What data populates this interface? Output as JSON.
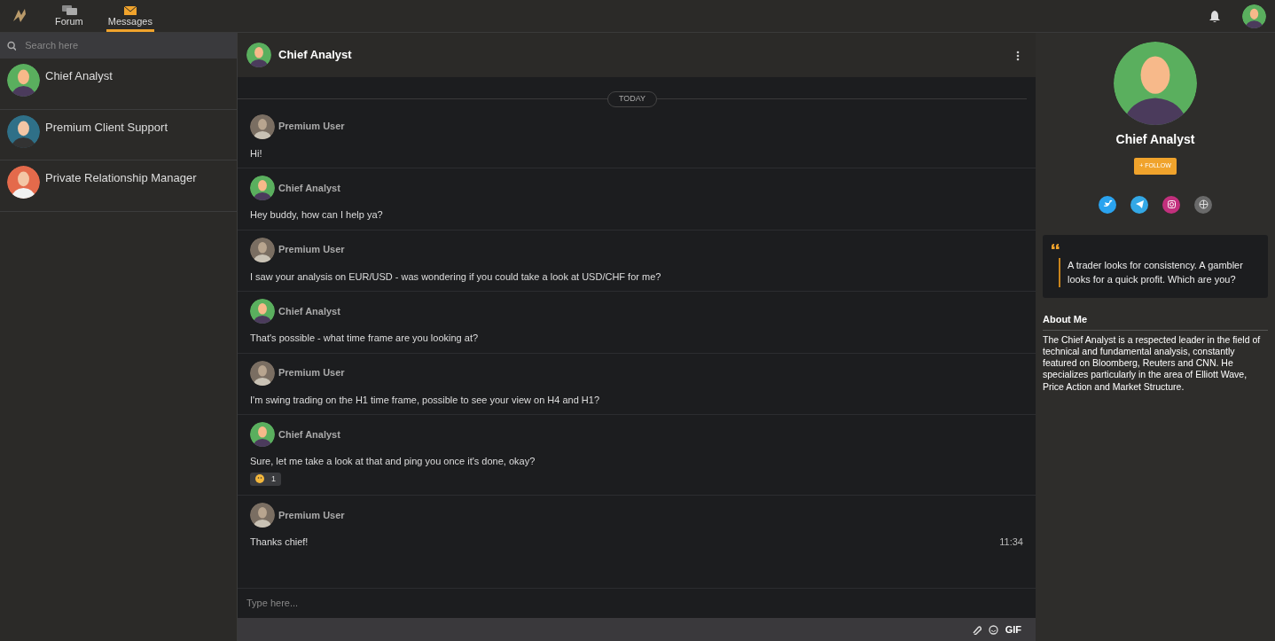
{
  "topbar": {
    "tabs": [
      {
        "label": "Forum",
        "selected": false
      },
      {
        "label": "Messages",
        "selected": true
      }
    ]
  },
  "sidebar": {
    "search": {
      "placeholder": "Search here"
    },
    "conversations": [
      {
        "name": "Chief Analyst",
        "kind": "analyst"
      },
      {
        "name": "Premium Client Support",
        "kind": "support"
      },
      {
        "name": "Private Relationship Manager",
        "kind": "manager"
      }
    ]
  },
  "chat": {
    "title": "Chief Analyst",
    "date_divider": "TODAY",
    "messages": [
      {
        "sender": "Premium User",
        "kind": "user",
        "text": "Hi!"
      },
      {
        "sender": "Chief Analyst",
        "kind": "analyst",
        "text": "Hey buddy, how can I help ya?"
      },
      {
        "sender": "Premium User",
        "kind": "user",
        "text": "I saw your analysis on EUR/USD - was wondering if you could take a look at USD/CHF for me?"
      },
      {
        "sender": "Chief Analyst",
        "kind": "analyst",
        "text": "That's possible - what time frame are you looking at?"
      },
      {
        "sender": "Premium User",
        "kind": "user",
        "text": "I'm swing trading on the H1 time frame, possible to see your view on H4 and H1?"
      },
      {
        "sender": "Chief Analyst",
        "kind": "analyst",
        "text": "Sure, let me take a look at that and ping you once it's done, okay?",
        "reaction": {
          "count": "1"
        }
      },
      {
        "sender": "Premium User",
        "kind": "user",
        "text": "Thanks chief!",
        "time": "11:34"
      }
    ],
    "input": {
      "placeholder": "Type here..."
    },
    "toolbar": {
      "gif": "GIF"
    }
  },
  "profile": {
    "name": "Chief Analyst",
    "follow": "+ FOLLOW",
    "socials": [
      {
        "kind": "twitter"
      },
      {
        "kind": "telegram"
      },
      {
        "kind": "instagram"
      },
      {
        "kind": "web"
      }
    ],
    "quote": "A trader looks for consistency. A gambler looks for a quick profit. Which are you?",
    "about_title": "About Me",
    "about": "The Chief Analyst is a respected leader in the field of technical and fundamental analysis, constantly featured on Bloomberg, Reuters and CNN. He specializes particularly in the area of Elliott Wave, Price Action and Market Structure."
  }
}
